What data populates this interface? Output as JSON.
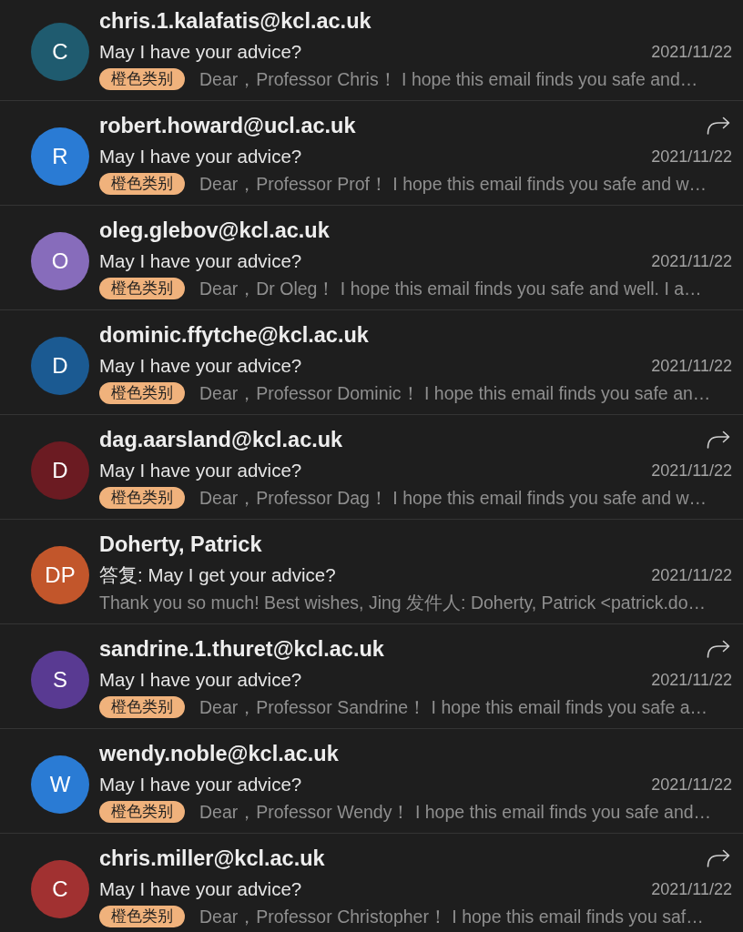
{
  "messages": [
    {
      "avatar": {
        "initials": "C",
        "color": "#1f5b6f"
      },
      "sender": "chris.1.kalafatis@kcl.ac.uk",
      "forwarded": false,
      "subject": "May I have your advice?",
      "date": "2021/11/22",
      "category": "橙色类别",
      "preview": "Dear，Professor Chris！ I hope this email finds you safe and…"
    },
    {
      "avatar": {
        "initials": "R",
        "color": "#2a7bd4"
      },
      "sender": "robert.howard@ucl.ac.uk",
      "forwarded": true,
      "subject": "May I have your advice?",
      "date": "2021/11/22",
      "category": "橙色类别",
      "preview": "Dear，Professor Prof！ I hope this email finds you safe and w…"
    },
    {
      "avatar": {
        "initials": "O",
        "color": "#876cbb"
      },
      "sender": "oleg.glebov@kcl.ac.uk",
      "forwarded": false,
      "subject": "May I have your advice?",
      "date": "2021/11/22",
      "category": "橙色类别",
      "preview": "Dear，Dr Oleg！ I hope this email finds you safe and well. I a…"
    },
    {
      "avatar": {
        "initials": "D",
        "color": "#1b5a92"
      },
      "sender": "dominic.ffytche@kcl.ac.uk",
      "forwarded": false,
      "subject": "May I have your advice?",
      "date": "2021/11/22",
      "category": "橙色类别",
      "preview": "Dear，Professor Dominic！ I hope this email finds you safe an…"
    },
    {
      "avatar": {
        "initials": "D",
        "color": "#6b1b22"
      },
      "sender": "dag.aarsland@kcl.ac.uk",
      "forwarded": true,
      "subject": "May I have your advice?",
      "date": "2021/11/22",
      "category": "橙色类别",
      "preview": "Dear，Professor Dag！ I hope this email finds you safe and w…"
    },
    {
      "avatar": {
        "initials": "DP",
        "color": "#c2562b"
      },
      "sender": "Doherty, Patrick",
      "forwarded": false,
      "subject": "答复: May I get your advice?",
      "date": "2021/11/22",
      "preview": "Thank you so much! Best wishes, Jing 发件人: Doherty, Patrick <patrick.do…"
    },
    {
      "avatar": {
        "initials": "S",
        "color": "#593a92"
      },
      "sender": "sandrine.1.thuret@kcl.ac.uk",
      "forwarded": true,
      "subject": "May I have your advice?",
      "date": "2021/11/22",
      "category": "橙色类别",
      "preview": "Dear，Professor Sandrine！ I hope this email finds you safe a…"
    },
    {
      "avatar": {
        "initials": "W",
        "color": "#2a7bd4"
      },
      "sender": "wendy.noble@kcl.ac.uk",
      "forwarded": false,
      "subject": "May I have your advice?",
      "date": "2021/11/22",
      "category": "橙色类别",
      "preview": "Dear，Professor Wendy！ I hope this email finds you safe and…"
    },
    {
      "avatar": {
        "initials": "C",
        "color": "#a13131"
      },
      "sender": "chris.miller@kcl.ac.uk",
      "forwarded": true,
      "subject": "May I have your advice?",
      "date": "2021/11/22",
      "category": "橙色类别",
      "preview": "Dear，Professor Christopher！ I hope this email finds you saf…"
    }
  ]
}
